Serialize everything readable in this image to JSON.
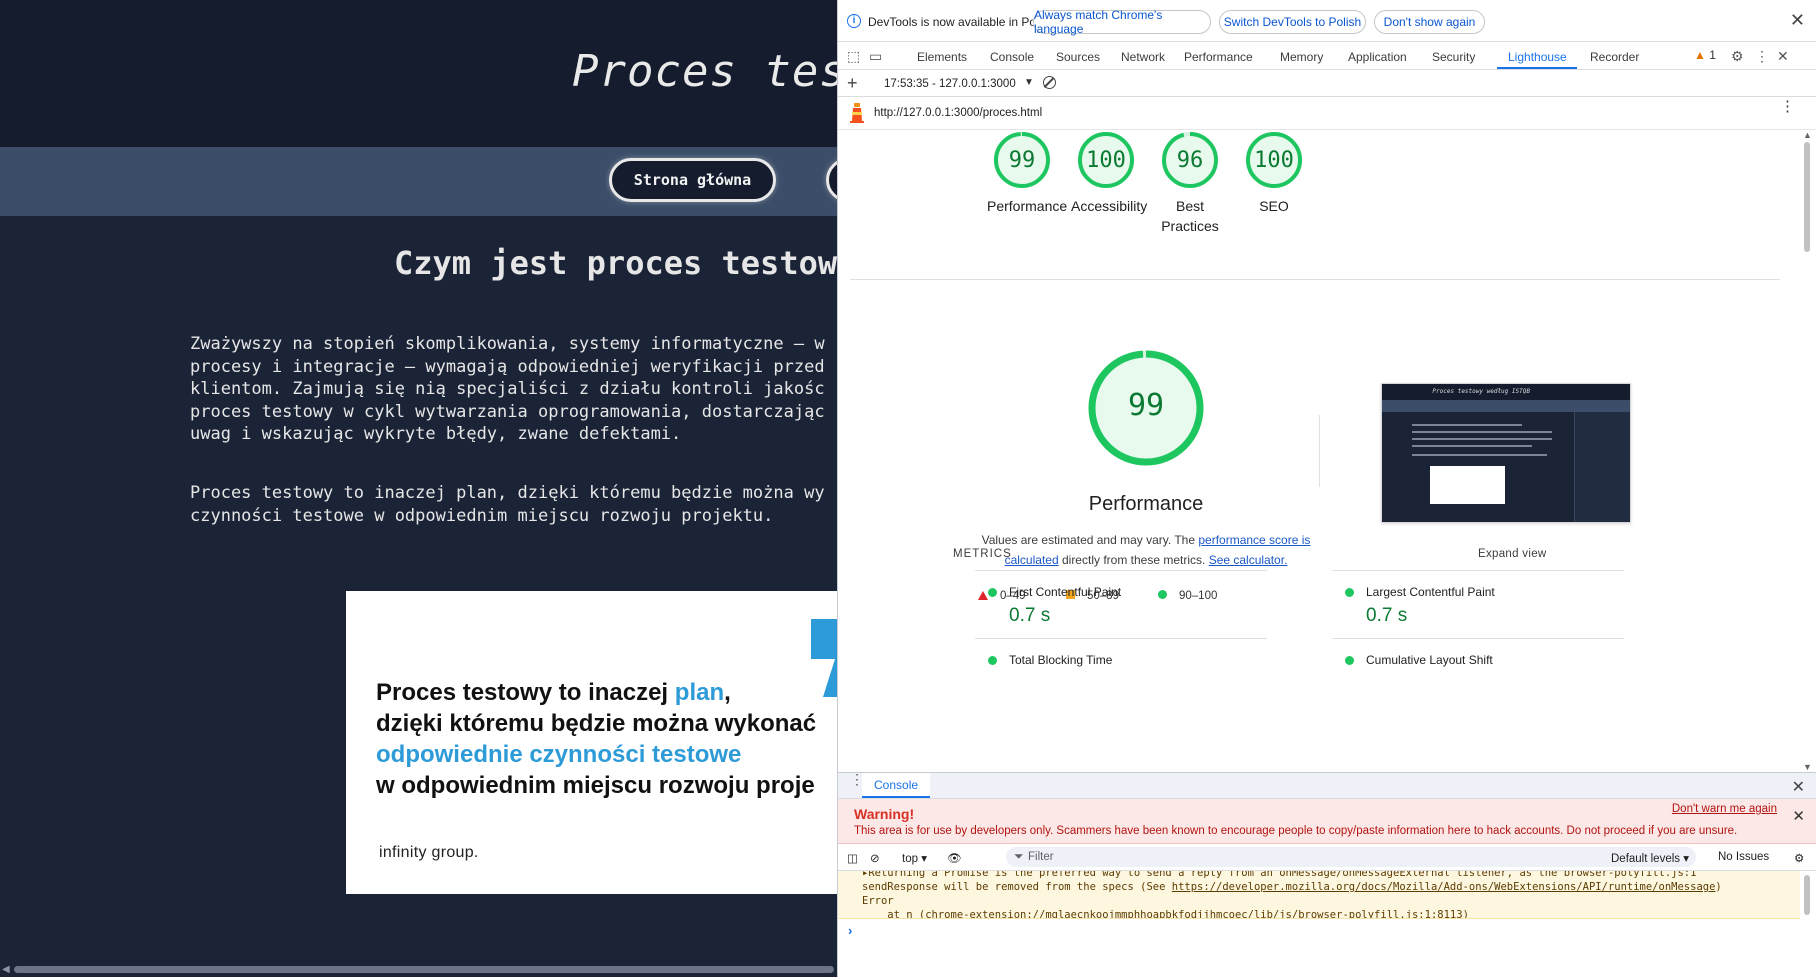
{
  "page": {
    "site_title": "Proces test",
    "nav": [
      "Strona główna"
    ],
    "heading": "Czym jest proces testow",
    "paragraph1": "Zważywszy na stopień skomplikowania, systemy informatyczne – w\nprocesy i integracje – wymagają odpowiedniej weryfikacji przed\nklientom. Zajmują się nią specjaliści z działu kontroli jakośc\nproces testowy w cykl wytwarzania oprogramowania, dostarczając\nuwag i wskazując wykryte błędy, zwane defektami.",
    "paragraph2": "Proces testowy to inaczej plan, dzięki któremu będzie można wy\nczynności testowe w odpowiednim miejscu rozwoju projektu.",
    "quote": {
      "line1_a": "Proces testowy to inaczej ",
      "line1_hl": "plan",
      "line1_b": ",",
      "line2": "dzięki któremu będzie można wykonać",
      "line3_hl": "odpowiednie czynności testowe",
      "line4": "w odpowiednim miejscu rozwoju proje",
      "logo": "infinity group."
    },
    "colors": {
      "background": "#1b2437",
      "accent": "#2d9bd8"
    }
  },
  "devtools": {
    "infobar": {
      "message": "DevTools is now available in Polish!",
      "btn_match": "Always match Chrome's language",
      "btn_switch": "Switch DevTools to Polish",
      "btn_dont_show": "Don't show again"
    },
    "tabs": [
      "Elements",
      "Console",
      "Sources",
      "Network",
      "Performance",
      "Memory",
      "Application",
      "Security",
      "Lighthouse",
      "Recorder"
    ],
    "active_tab": "Lighthouse",
    "warning_count": "1",
    "report_selector": "17:53:35 - 127.0.0.1:3000",
    "url": "http://127.0.0.1:3000/proces.html",
    "scores": [
      {
        "label": "Performance",
        "value": "99",
        "score": 99
      },
      {
        "label": "Accessibility",
        "value": "100",
        "score": 100
      },
      {
        "label": "Best Practices",
        "value": "96",
        "score": 96
      },
      {
        "label": "SEO",
        "value": "100",
        "score": 100
      }
    ],
    "performance": {
      "score": "99",
      "score_value": 99,
      "title": "Performance",
      "note_a": "Values are estimated and may vary. The ",
      "note_link1": "performance score is calculated",
      "note_b": " directly from these metrics. ",
      "note_link2": "See calculator.",
      "legend": [
        "0–49",
        "50–89",
        "90–100"
      ]
    },
    "metrics_heading": "METRICS",
    "expand_view": "Expand view",
    "metrics": [
      {
        "name": "First Contentful Paint",
        "value": "0.7 s"
      },
      {
        "name": "Largest Contentful Paint",
        "value": "0.7 s"
      },
      {
        "name": "Total Blocking Time",
        "value": ""
      },
      {
        "name": "Cumulative Layout Shift",
        "value": ""
      }
    ],
    "thumbnail": {
      "title": "Proces testowy według ISTQB"
    },
    "console": {
      "tab": "Console",
      "warning_title": "Warning!",
      "warning_text": "This area is for use by developers only. Scammers have been known to encourage people to copy/paste information here to hack accounts. Do not proceed if you are unsure.",
      "dont_warn": "Don't warn me again",
      "context": "top",
      "filter_placeholder": "Filter",
      "levels": "Default levels",
      "issues": "No Issues",
      "log_line0": "▸Returning a Promise is the preferred way to send a reply from an onMessage/onMessageExternal listener, as the     browser-polyfill.js:1",
      "log_line1_a": "sendResponse will be removed from the specs (See ",
      "log_line1_link": "https://developer.mozilla.org/docs/Mozilla/Add-ons/WebExtensions/API/runtime/onMessage",
      "log_line1_b": ")",
      "log_line2": "Error",
      "log_line3_a": "    at n (",
      "log_line3_link": "chrome-extension://mglaecnkoojmmphhoapbkfodjjhmcoec/lib/js/browser-polyfill.js:1:8113",
      "log_line3_b": ")",
      "prompt": "›"
    }
  }
}
